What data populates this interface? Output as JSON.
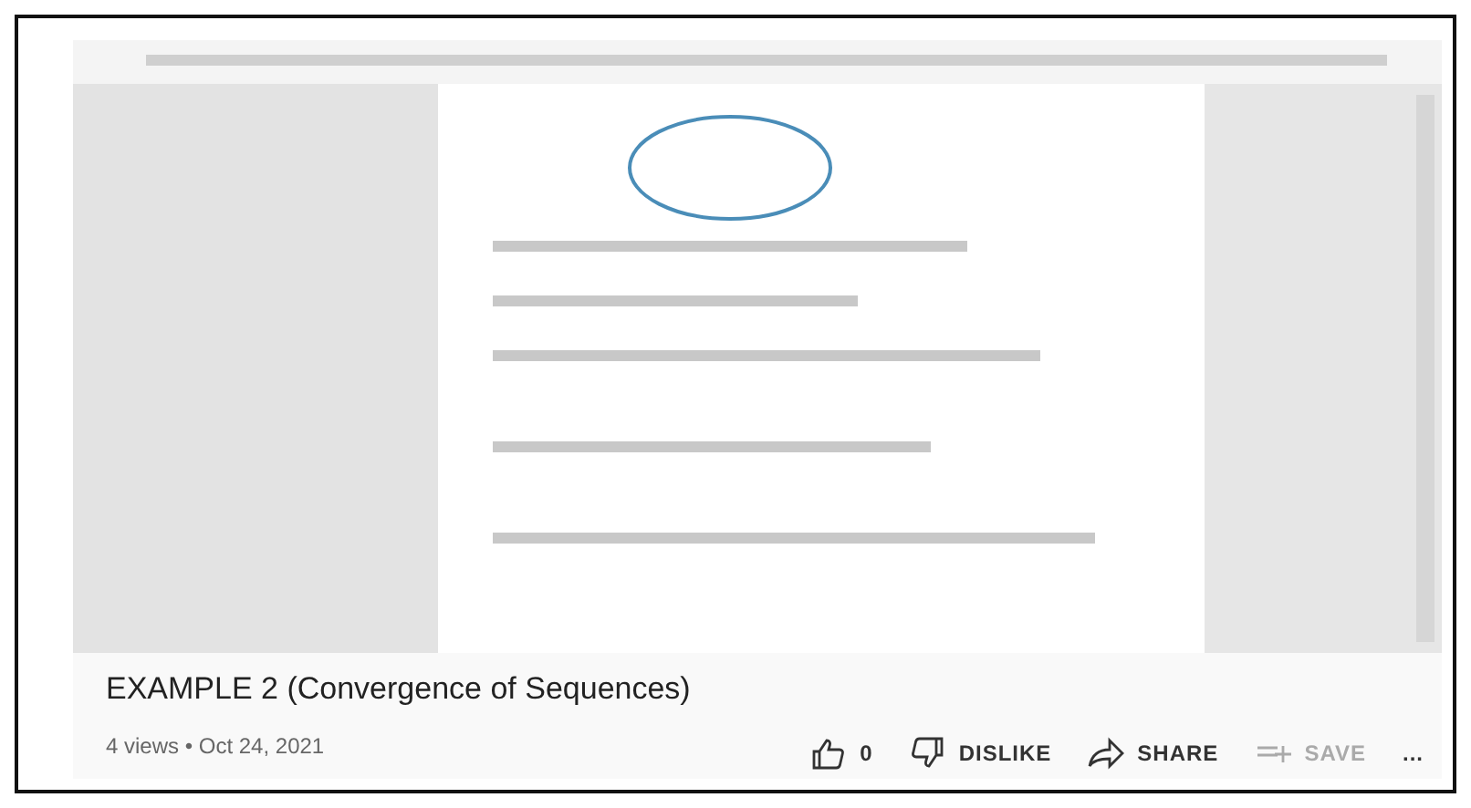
{
  "title": "EXAMPLE 2 (Convergence of Sequences)",
  "meta": "4 views • Oct 24, 2021",
  "actions": [
    {
      "kind": "like",
      "label": "0",
      "disabled": false
    },
    {
      "kind": "dislike",
      "label": "DISLIKE",
      "disabled": false
    },
    {
      "kind": "share",
      "label": "SHARE",
      "disabled": false
    },
    {
      "kind": "save",
      "label": "SAVE",
      "disabled": true
    },
    {
      "kind": "more",
      "label": "...",
      "disabled": false
    }
  ]
}
